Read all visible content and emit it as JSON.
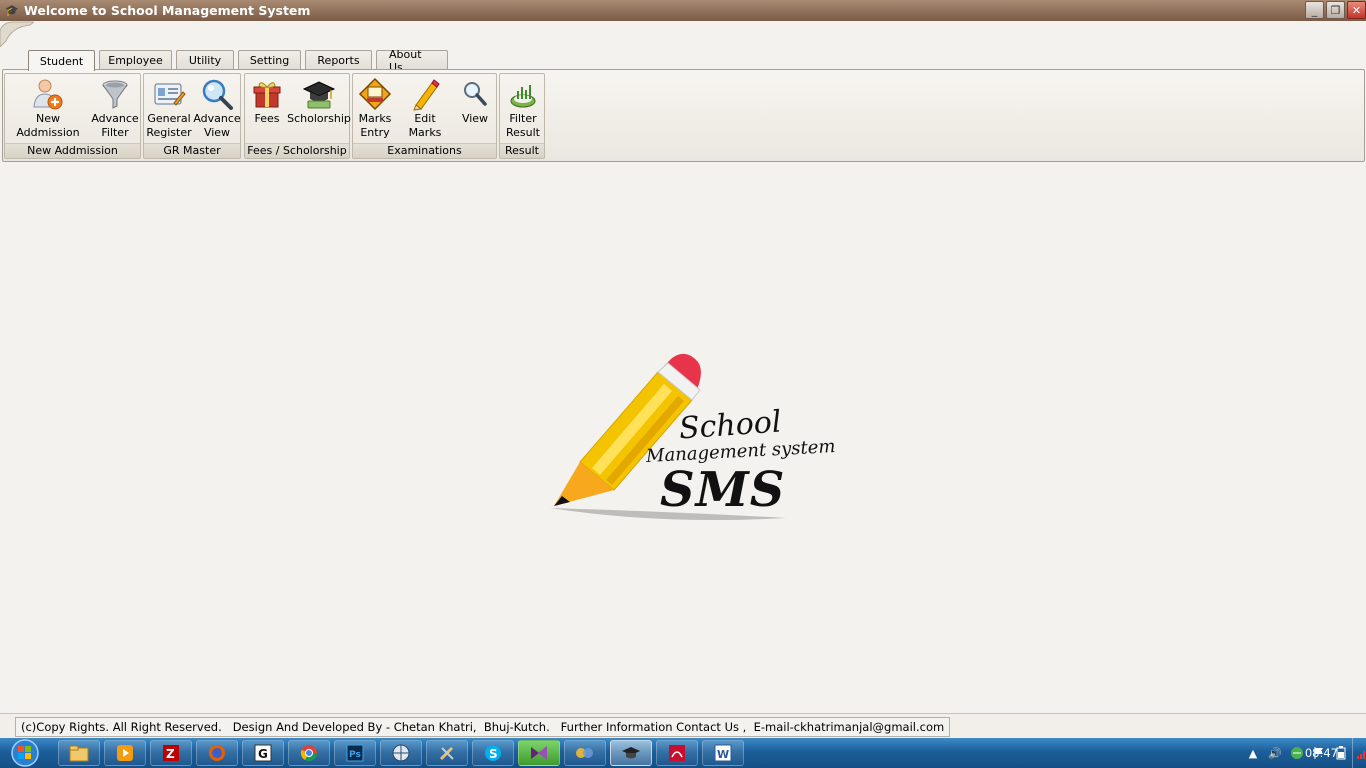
{
  "window": {
    "title": "Welcome to School Management System",
    "min_glyph": "_",
    "restore_glyph": "❐",
    "close_glyph": "✕"
  },
  "tabs": [
    "Student",
    "Employee",
    "Utility",
    "Setting",
    "Reports",
    "About Us"
  ],
  "active_tab": "Student",
  "ribbon": {
    "groups": [
      {
        "label": "New Addmission",
        "buttons": [
          {
            "label": "New Addmission",
            "icon": "user-add-icon"
          },
          {
            "label": "Advance\nFilter",
            "icon": "filter-funnel-icon"
          }
        ]
      },
      {
        "label": "GR Master",
        "buttons": [
          {
            "label": "General\nRegister",
            "icon": "register-card-icon"
          },
          {
            "label": "Advance\nView",
            "icon": "magnify-view-icon"
          }
        ]
      },
      {
        "label": "Fees / Scholorship",
        "buttons": [
          {
            "label": "Fees",
            "icon": "gift-fees-icon"
          },
          {
            "label": "Scholorship",
            "icon": "graduation-cap-icon"
          }
        ]
      },
      {
        "label": "Examinations",
        "buttons": [
          {
            "label": "Marks\nEntry",
            "icon": "exam-sign-icon"
          },
          {
            "label": "Edit Marks",
            "icon": "pencil-icon"
          },
          {
            "label": "View",
            "icon": "magnifier-icon"
          }
        ]
      },
      {
        "label": "Result",
        "buttons": [
          {
            "label": "Filter\nResult",
            "icon": "chart-result-icon"
          }
        ]
      }
    ]
  },
  "logo": {
    "line1": "School",
    "line2": "Management system",
    "line3": "SMS",
    "colors": {
      "pencil": "#f5c400",
      "eraser": "#e8344a",
      "text": "#111111"
    }
  },
  "status": {
    "text": "(c)Copy Rights. All Right Reserved.   Design And Developed By - Chetan Khatri,  Bhuj-Kutch.   Further Information Contact Us ,  E-mail-ckhatrimanjal@gmail.com"
  },
  "taskbar": {
    "items": [
      {
        "icon": "file-explorer-icon"
      },
      {
        "icon": "media-player-icon"
      },
      {
        "icon": "filezilla-icon"
      },
      {
        "icon": "firefox-icon"
      },
      {
        "icon": "g-app-icon"
      },
      {
        "icon": "chrome-icon"
      },
      {
        "icon": "photoshop-icon"
      },
      {
        "icon": "app-globe-icon"
      },
      {
        "icon": "tools-icon"
      },
      {
        "icon": "skype-icon"
      },
      {
        "icon": "visual-studio-icon"
      },
      {
        "icon": "app-multi-icon"
      },
      {
        "icon": "sms-app-icon",
        "active": true
      },
      {
        "icon": "pdf-reader-icon"
      },
      {
        "icon": "word-icon"
      }
    ],
    "clock": "08:47"
  }
}
